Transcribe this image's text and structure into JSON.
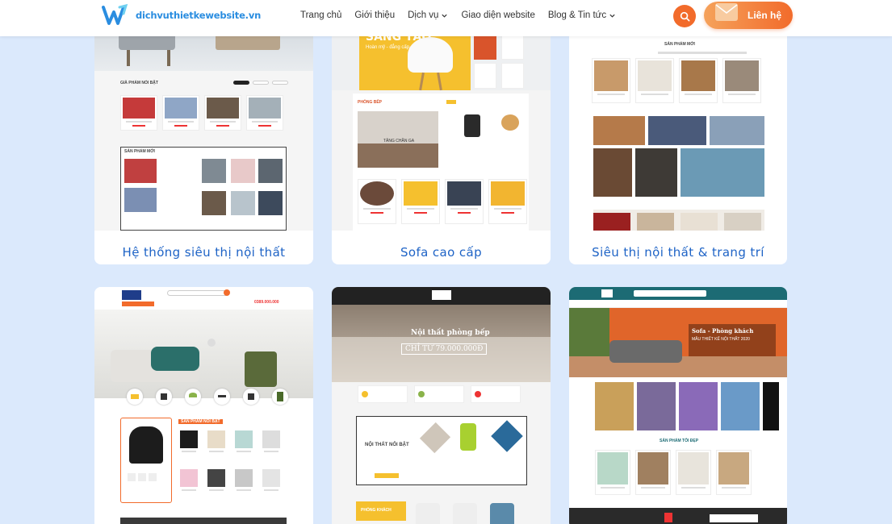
{
  "brand": {
    "name": "dichvuthietkewebsite.vn"
  },
  "nav": [
    {
      "label": "Trang chủ",
      "has_dropdown": false
    },
    {
      "label": "Giới thiệu",
      "has_dropdown": false
    },
    {
      "label": "Dịch vụ",
      "has_dropdown": true
    },
    {
      "label": "Giao diện website",
      "has_dropdown": false
    },
    {
      "label": "Blog & Tin tức",
      "has_dropdown": true
    }
  ],
  "contact_button": {
    "label": "Liên hệ"
  },
  "colors": {
    "accent": "#f26b2b",
    "brand": "#2a8de0",
    "title": "#1e63c6",
    "page_bg": "#dbe9fc"
  },
  "cards": [
    {
      "title": "Hệ thống siêu thị nội thất",
      "shot": {
        "section": "GIÀ PHẨM NỔI BẬT",
        "section2": "SẢN PHẨM MỚI"
      }
    },
    {
      "title": "Sofa cao cấp",
      "shot": {
        "banner": "SANG TẠO",
        "banner_sub": "Hoàn mỹ - đẳng cấp",
        "section": "PHÒNG BẾP",
        "promo": "TĂNG CHẦN GA"
      }
    },
    {
      "title": "Siêu thị nội thất & trang trí",
      "shot": {
        "section": "SẢN PHẨM MỚI"
      }
    },
    {
      "title": "",
      "shot": {
        "phone": "0389.000.000",
        "section": "SẢN PHẨM NỔI BẬT"
      }
    },
    {
      "title": "",
      "shot": {
        "banner": "Nội thất phòng bếp",
        "price": "CHỈ TỪ 79.000.000Đ",
        "section": "NỘI THẤT NỔI BẬT",
        "section2": "PHÒNG KHÁCH"
      }
    },
    {
      "title": "",
      "shot": {
        "banner": "Sofa - Phòng khách",
        "banner_sub": "MẪU THIẾT KẾ NỘI THẤT 2020",
        "section": "SẢN PHẨM TỐI ĐẸP"
      }
    }
  ]
}
